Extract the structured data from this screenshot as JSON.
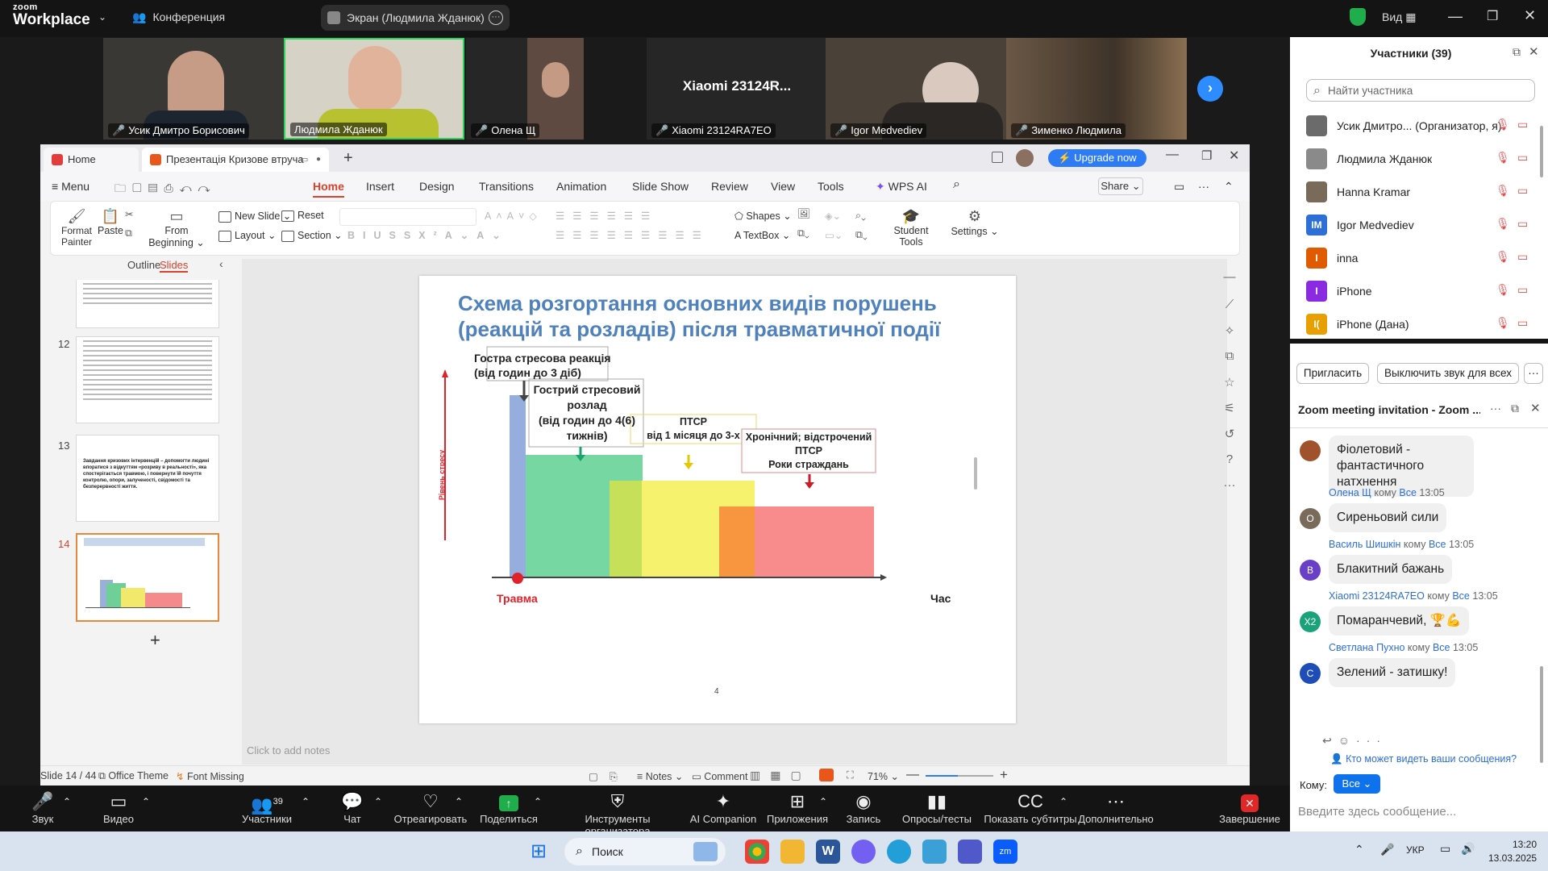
{
  "zoom": {
    "brand_small": "zoom",
    "brand_big": "Workplace",
    "conference_label": "Конференция",
    "share_label": "Экран (Людмила Жданюк)",
    "view_label": "Вид",
    "video_tiles": [
      {
        "name": "Усик Дмитро Борисович"
      },
      {
        "name": "Людмила Жданюк"
      },
      {
        "name": "Олена Щ"
      },
      {
        "name": "Xiaomi 23124RA7EO",
        "display_title": "Xiaomi 23124R..."
      },
      {
        "name": "Igor Medvediev"
      },
      {
        "name": "Зименко Людмила"
      }
    ],
    "participants": {
      "title": "Участники (39)",
      "search_placeholder": "Найти участника",
      "list": [
        {
          "name": "Усик Дмитро... (Организатор, я)",
          "avatar": "",
          "color": "#6b6b6b"
        },
        {
          "name": "Людмила Жданюк",
          "avatar": "",
          "color": "#8a8a8a"
        },
        {
          "name": "Hanna Kramar",
          "avatar": "",
          "color": "#7a6a5a"
        },
        {
          "name": "Igor Medvediev",
          "avatar": "IM",
          "color": "#2d6fd6"
        },
        {
          "name": "inna",
          "avatar": "I",
          "color": "#e05a00"
        },
        {
          "name": "iPhone",
          "avatar": "I",
          "color": "#8a2be2"
        },
        {
          "name": "iPhone (Дана)",
          "avatar": "I(",
          "color": "#e8a000"
        }
      ],
      "invite_button": "Пригласить",
      "mute_all_button": "Выключить звук для всех"
    },
    "chat": {
      "title": "Zoom meeting invitation - Zoom ...",
      "messages": [
        {
          "sender": "",
          "to": "",
          "time": "",
          "text": "Фіолетовий - фантастичного натхнення",
          "avatar": "",
          "color": "#a0522d"
        },
        {
          "sender": "Олена Щ",
          "to": "Все",
          "time": "13:05",
          "text": "Сиреньовий сили",
          "avatar": "О",
          "color": "#7a6a5a"
        },
        {
          "sender": "Василь Шишкін",
          "to": "Все",
          "time": "13:05",
          "text": "Блакитний бажань",
          "avatar": "В",
          "color": "#6a3fc8"
        },
        {
          "sender": "Xiaomi 23124RA7EO",
          "to": "Все",
          "time": "13:05",
          "text": "Помаранчевий, 🏆💪",
          "avatar": "X2",
          "color": "#1aa37a"
        },
        {
          "sender": "Светлана Пухно",
          "to": "Все",
          "time": "13:05",
          "text": "Зелений - затишку!",
          "avatar": "С",
          "color": "#1e4db7"
        }
      ],
      "to_word": "кому",
      "who_can_see": "Кто может видеть ваши сообщения?",
      "to_label": "Кому:",
      "to_value": "Все",
      "input_placeholder": "Введите здесь сообщение..."
    },
    "controls": {
      "audio": "Звук",
      "video": "Видео",
      "participants": "Участники",
      "participants_count": "39",
      "chat": "Чат",
      "react": "Отреагировать",
      "share": "Поделиться",
      "host_tools": "Инструменты организатора",
      "ai": "AI Companion",
      "apps": "Приложения",
      "record": "Запись",
      "polls": "Опросы/тесты",
      "captions": "Показать субтитры",
      "more": "Дополнительно",
      "end": "Завершение"
    }
  },
  "wps": {
    "tabs": [
      {
        "label": "Home"
      },
      {
        "label": "Презентація Кризове втруча"
      }
    ],
    "upgrade": "Upgrade now",
    "menu": [
      "Menu",
      "Home",
      "Insert",
      "Design",
      "Transitions",
      "Animation",
      "Slide Show",
      "Review",
      "View",
      "Tools",
      "WPS AI"
    ],
    "share": "Share",
    "ribbon": {
      "format_painter": "Format Painter",
      "paste": "Paste",
      "from_beginning": "From Beginning",
      "new_slide": "New Slide",
      "reset": "Reset",
      "layout": "Layout",
      "section": "Section",
      "shapes": "Shapes",
      "textbox": "TextBox",
      "student_tools": "Student Tools",
      "settings": "Settings"
    },
    "panel": {
      "outline": "Outline",
      "slides": "Slides",
      "thumb_numbers": [
        "12",
        "13",
        "14"
      ],
      "thumb13_text": "Завдання кризових інтервенцій – допомогти людині впоратися з відкуттям «розриву в реальності», яка спостерігається травмою, і повернути їй почуття контролю, опори, залученості, свідомості та безперервності життя."
    },
    "slide": {
      "title": "Схема розгортання основних видів порушень (реакцій та розладів) після травматичної події",
      "acute_reaction": [
        "Гостра стресова реакція",
        "(від годин до 3 діб)"
      ],
      "acute_disorder": [
        "Гострий стресовий",
        "розлад",
        "(від годин до 4(6)",
        "тижнів)"
      ],
      "ptsd": [
        "ПТСР",
        "від 1 місяця до 3-х"
      ],
      "chronic": [
        "Хронічний; відстрочений",
        "ПТСР",
        "Роки страждань"
      ],
      "yaxis": "Рівень стресу",
      "trauma": "Травма",
      "time": "Час",
      "page": "4"
    },
    "notes_placeholder": "Click to add notes",
    "status": {
      "slide": "Slide 14 / 44",
      "theme": "Office Theme",
      "font": "Font Missing",
      "notes": "Notes",
      "comment": "Comment",
      "zoom": "71%"
    }
  },
  "taskbar": {
    "search": "Поиск",
    "lang": "УКР",
    "time": "13:20",
    "date": "13.03.2025"
  }
}
